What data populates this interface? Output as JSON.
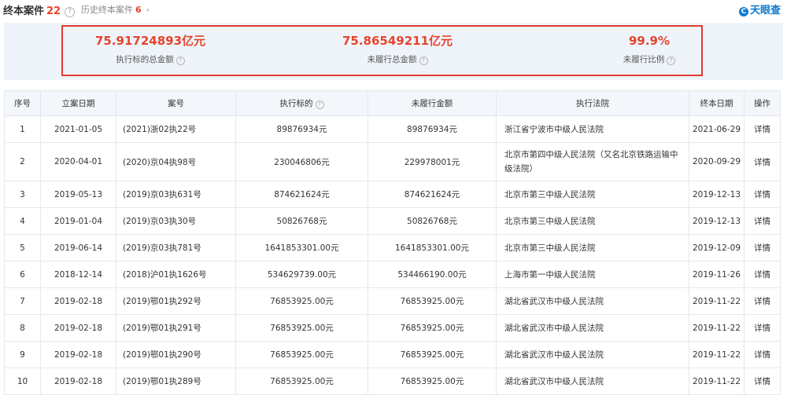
{
  "header": {
    "title": "终本案件",
    "count": "22",
    "history_label": "历史终本案件",
    "history_count": "6",
    "logo_mark": "C",
    "logo_text": "天眼查"
  },
  "summary": {
    "total_executed": {
      "value": "75.91724893亿元",
      "label": "执行标的总金额"
    },
    "total_unperformed": {
      "value": "75.86549211亿元",
      "label": "未履行总金额"
    },
    "unperformed_ratio": {
      "value": "99.9%",
      "label": "未履行比例"
    }
  },
  "table": {
    "headers": [
      "序号",
      "立案日期",
      "案号",
      "执行标的",
      "未履行金额",
      "执行法院",
      "终本日期",
      "操作"
    ],
    "rows": [
      {
        "no": "1",
        "filed": "2021-01-05",
        "case": "(2021)浙02执22号",
        "amount": "89876934元",
        "unpaid": "89876934元",
        "court": "浙江省宁波市中级人民法院",
        "closed": "2021-06-29",
        "action": "详情"
      },
      {
        "no": "2",
        "filed": "2020-04-01",
        "case": "(2020)京04执98号",
        "amount": "230046806元",
        "unpaid": "229978001元",
        "court": "北京市第四中级人民法院（又名北京铁路运输中级法院）",
        "closed": "2020-09-29",
        "action": "详情"
      },
      {
        "no": "3",
        "filed": "2019-05-13",
        "case": "(2019)京03执631号",
        "amount": "874621624元",
        "unpaid": "874621624元",
        "court": "北京市第三中级人民法院",
        "closed": "2019-12-13",
        "action": "详情"
      },
      {
        "no": "4",
        "filed": "2019-01-04",
        "case": "(2019)京03执30号",
        "amount": "50826768元",
        "unpaid": "50826768元",
        "court": "北京市第三中级人民法院",
        "closed": "2019-12-13",
        "action": "详情"
      },
      {
        "no": "5",
        "filed": "2019-06-14",
        "case": "(2019)京03执781号",
        "amount": "1641853301.00元",
        "unpaid": "1641853301.00元",
        "court": "北京市第三中级人民法院",
        "closed": "2019-12-09",
        "action": "详情"
      },
      {
        "no": "6",
        "filed": "2018-12-14",
        "case": "(2018)沪01执1626号",
        "amount": "534629739.00元",
        "unpaid": "534466190.00元",
        "court": "上海市第一中级人民法院",
        "closed": "2019-11-26",
        "action": "详情"
      },
      {
        "no": "7",
        "filed": "2019-02-18",
        "case": "(2019)鄂01执292号",
        "amount": "76853925.00元",
        "unpaid": "76853925.00元",
        "court": "湖北省武汉市中级人民法院",
        "closed": "2019-11-22",
        "action": "详情"
      },
      {
        "no": "8",
        "filed": "2019-02-18",
        "case": "(2019)鄂01执291号",
        "amount": "76853925.00元",
        "unpaid": "76853925.00元",
        "court": "湖北省武汉市中级人民法院",
        "closed": "2019-11-22",
        "action": "详情"
      },
      {
        "no": "9",
        "filed": "2019-02-18",
        "case": "(2019)鄂01执290号",
        "amount": "76853925.00元",
        "unpaid": "76853925.00元",
        "court": "湖北省武汉市中级人民法院",
        "closed": "2019-11-22",
        "action": "详情"
      },
      {
        "no": "10",
        "filed": "2019-02-18",
        "case": "(2019)鄂01执289号",
        "amount": "76853925.00元",
        "unpaid": "76853925.00元",
        "court": "湖北省武汉市中级人民法院",
        "closed": "2019-11-22",
        "action": "详情"
      }
    ]
  }
}
